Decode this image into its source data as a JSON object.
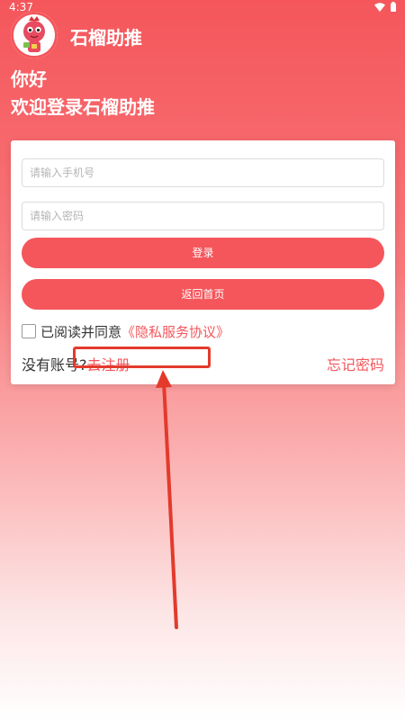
{
  "status": {
    "time": "4:37"
  },
  "header": {
    "app_title": "石榴助推",
    "greeting": "你好",
    "welcome": "欢迎登录石榴助推"
  },
  "form": {
    "phone_placeholder": "请输入手机号",
    "password_placeholder": "请输入密码",
    "login_label": "登录",
    "home_label": "返回首页",
    "agree_text": "已阅读并同意",
    "agreement_link": "《隐私服务协议》",
    "no_account_text": "没有账号?",
    "register_link": "去注册",
    "forgot_link": "忘记密码"
  },
  "colors": {
    "accent": "#f4565b",
    "annotation": "#e33a2c"
  }
}
